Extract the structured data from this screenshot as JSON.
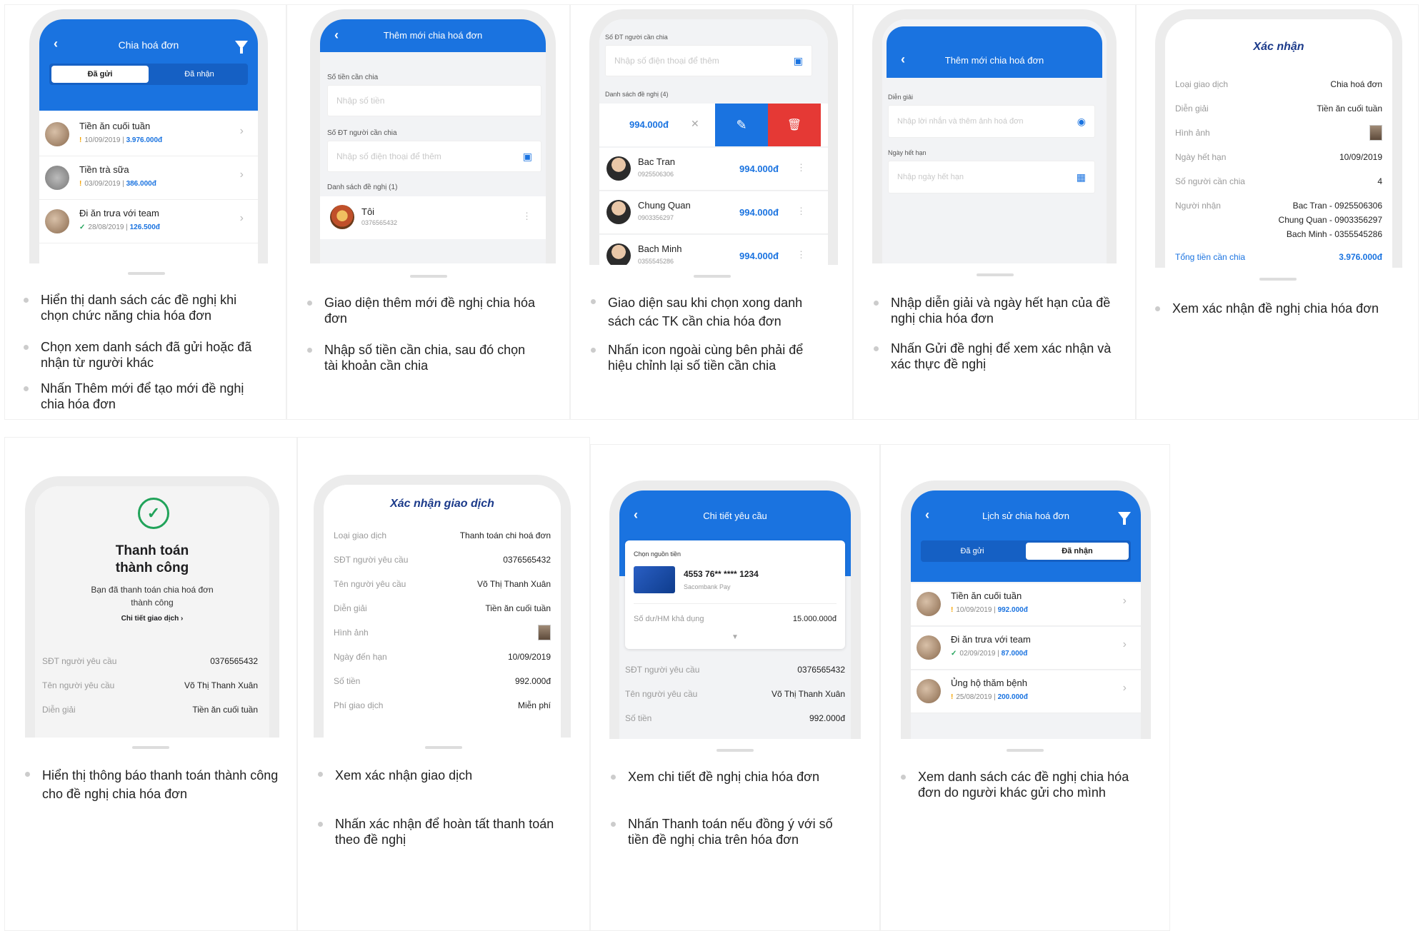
{
  "cards": [
    {
      "header_title": "Chia hoá đơn",
      "tab_sent": "Đã gửi",
      "tab_received": "Đã nhận",
      "rows": [
        {
          "title": "Tiền ăn cuối tuần",
          "date": "10/09/2019",
          "amount": "3.976.000đ",
          "status": "pending"
        },
        {
          "title": "Tiền trà sữa",
          "date": "03/09/2019",
          "amount": "386.000đ",
          "status": "pending"
        },
        {
          "title": "Đi ăn trưa với team",
          "date": "28/08/2019",
          "amount": "126.500đ",
          "status": "done"
        }
      ],
      "bullets": [
        "Hiển thị danh sách các đề nghị khi chọn chức năng chia hóa đơn",
        "Chọn xem danh sách đã gửi hoặc đã nhận từ người khác",
        "Nhấn Thêm mới để tạo mới đề nghị chia hóa đơn"
      ]
    },
    {
      "header_title": "Thêm mới chia hoá đơn",
      "amount_label": "Số tiền cần chia",
      "amount_placeholder": "Nhập số tiền",
      "phone_label": "Số ĐT người cần chia",
      "phone_placeholder": "Nhập số điện thoại để thêm",
      "list_label": "Danh sách đề nghị (1)",
      "person_name": "Tôi",
      "person_phone": "0376565432",
      "bullets": [
        "Giao diện thêm mới đề nghị chia hóa đơn",
        "Nhập số tiền cần chia, sau đó chọn tài khoản cần chia"
      ]
    },
    {
      "phone_label": "Số ĐT người cần chia",
      "phone_placeholder": "Nhập số điện thoại để thêm",
      "list_label": "Danh sách đề nghị (4)",
      "edit_amount": "994.000đ",
      "people": [
        {
          "name": "Bac Tran",
          "phone": "0925506306",
          "amount": "994.000đ"
        },
        {
          "name": "Chung Quan",
          "phone": "0903356297",
          "amount": "994.000đ"
        },
        {
          "name": "Bach Minh",
          "phone": "0355545286",
          "amount": "994.000đ"
        }
      ],
      "bullets": [
        "Giao diện sau khi chọn xong danh sách các TK cần chia hóa đơn",
        "Nhấn icon ngoài cùng bên phải để hiệu chỉnh lại số tiền cần chia"
      ]
    },
    {
      "header_title": "Thêm mới chia hoá đơn",
      "desc_label": "Diễn giải",
      "desc_placeholder": "Nhập lời nhắn và thêm ảnh hoá đơn",
      "due_label": "Ngày hết hạn",
      "due_placeholder": "Nhập ngày hết hạn",
      "bullets": [
        "Nhập diễn giải và ngày hết hạn của đề nghị chia hóa đơn",
        "Nhấn Gửi đề nghị để xem xác nhận và xác thực đề nghị"
      ]
    },
    {
      "title": "Xác nhận",
      "fields": [
        {
          "k": "Loại giao dịch",
          "v": "Chia hoá đơn"
        },
        {
          "k": "Diễn giải",
          "v": "Tiền ăn cuối tuần"
        },
        {
          "k": "Hình ảnh",
          "v": ""
        },
        {
          "k": "Ngày hết hạn",
          "v": "10/09/2019"
        },
        {
          "k": "Số người cần chia",
          "v": "4"
        }
      ],
      "recipients_label": "Người nhận",
      "recipients": [
        "Bac Tran - 0925506306",
        "Chung Quan - 0903356297",
        "Bach Minh - 0355545286"
      ],
      "total_label": "Tổng tiền cần chia",
      "total_value": "3.976.000đ",
      "bullets": [
        "Xem xác nhận đề nghị chia hóa đơn"
      ]
    },
    {
      "success_title_1": "Thanh toán",
      "success_title_2": "thành công",
      "success_msg_1": "Bạn đã thanh toán chia hoá đơn",
      "success_msg_2": "thành công",
      "detail_link": "Chi tiết giao dịch",
      "fields": [
        {
          "k": "SĐT người yêu cầu",
          "v": "0376565432"
        },
        {
          "k": "Tên người yêu cầu",
          "v": "Võ Thị Thanh Xuân"
        },
        {
          "k": "Diễn giải",
          "v": "Tiền ăn cuối tuần"
        }
      ],
      "bullets": [
        "Hiển thị thông báo thanh toán thành công cho đề nghị chia hóa đơn"
      ]
    },
    {
      "title": "Xác nhận giao dịch",
      "fields": [
        {
          "k": "Loại giao dịch",
          "v": "Thanh toán chi hoá đơn"
        },
        {
          "k": "SĐT người yêu cầu",
          "v": "0376565432"
        },
        {
          "k": "Tên người yêu cầu",
          "v": "Võ Thị Thanh Xuân"
        },
        {
          "k": "Diễn giải",
          "v": "Tiền ăn cuối tuần"
        },
        {
          "k": "Hình ảnh",
          "v": ""
        },
        {
          "k": "Ngày đến hạn",
          "v": "10/09/2019"
        },
        {
          "k": "Số tiền",
          "v": "992.000đ"
        },
        {
          "k": "Phí giao dịch",
          "v": "Miễn phí"
        }
      ],
      "bullets": [
        "Xem xác nhận giao dịch",
        "Nhấn xác nhận để hoàn tất thanh toán theo đề nghị"
      ]
    },
    {
      "header_title": "Chi tiết yêu cầu",
      "source_label": "Chọn nguồn tiền",
      "card_number": "4553 76** **** 1234",
      "bank_name": "Sacombank Pay",
      "balance_label": "Số dư/HM khả dụng",
      "balance_value": "15.000.000đ",
      "fields": [
        {
          "k": "SĐT người yêu cầu",
          "v": "0376565432"
        },
        {
          "k": "Tên người yêu cầu",
          "v": "Võ Thị Thanh Xuân"
        },
        {
          "k": "Số tiền",
          "v": "992.000đ"
        }
      ],
      "bullets": [
        "Xem chi tiết đề nghị chia hóa đơn",
        "Nhấn Thanh toán nếu đồng ý với số tiền đề nghị chia trên hóa đơn"
      ]
    },
    {
      "header_title": "Lịch sử chia hoá đơn",
      "tab_sent": "Đã gửi",
      "tab_received": "Đã nhận",
      "rows": [
        {
          "title": "Tiền ăn cuối tuần",
          "date": "10/09/2019",
          "amount": "992.000đ",
          "status": "pending"
        },
        {
          "title": "Đi ăn trưa với team",
          "date": "02/09/2019",
          "amount": "87.000đ",
          "status": "done"
        },
        {
          "title": "Ủng hộ thăm bệnh",
          "date": "25/08/2019",
          "amount": "200.000đ",
          "status": "pending"
        }
      ],
      "bullets": [
        "Xem danh sách các đề nghị chia hóa đơn do người khác gửi cho mình"
      ]
    }
  ],
  "colors": {
    "primary": "#1a73e0",
    "danger": "#e53935",
    "success": "#21a35a",
    "warning": "#f5a300",
    "title_blue": "#1b3a8a"
  }
}
